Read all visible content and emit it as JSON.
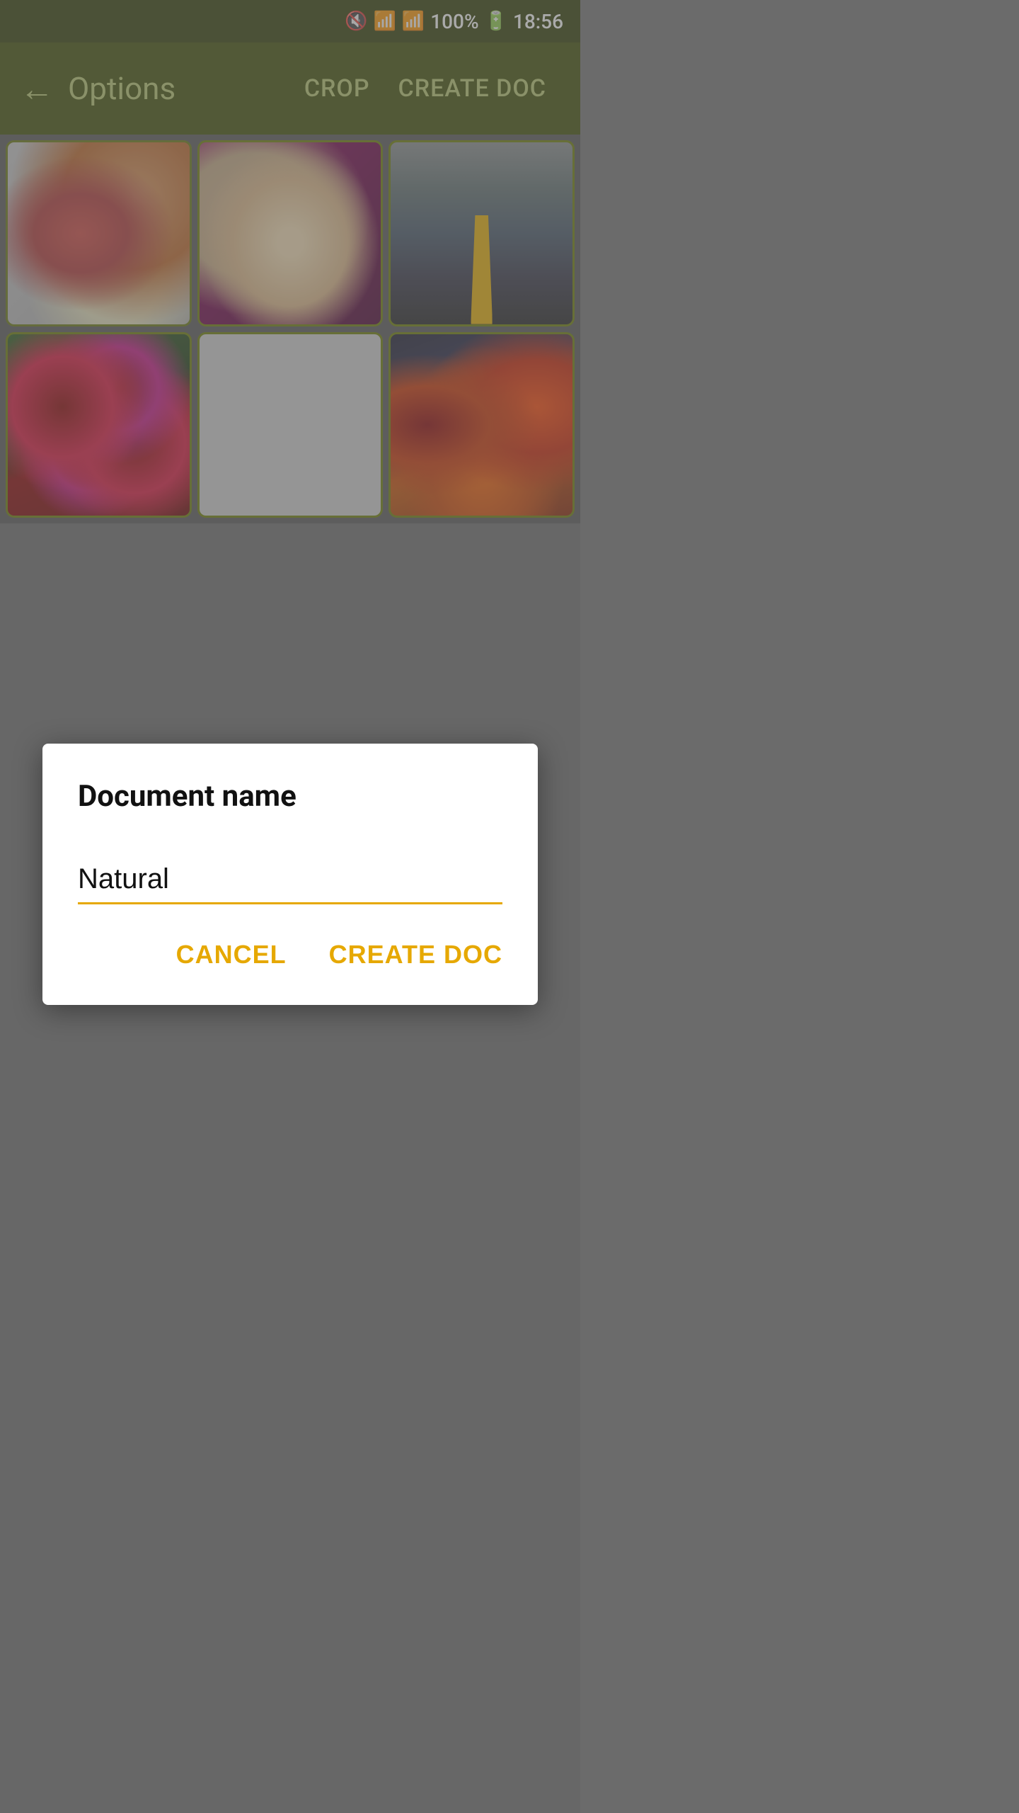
{
  "statusBar": {
    "time": "18:56",
    "battery": "100%",
    "icons": [
      "mute-icon",
      "wifi-icon",
      "signal-icon",
      "battery-icon"
    ]
  },
  "appBar": {
    "backLabel": "←",
    "title": "Options",
    "cropLabel": "CROP",
    "createDocLabel": "CREATE DOC"
  },
  "imageGrid": {
    "cells": [
      {
        "id": "flowers",
        "alt": "Floral fabric"
      },
      {
        "id": "dolphin",
        "alt": "Dolphin sculpture"
      },
      {
        "id": "road",
        "alt": "Autumn road"
      },
      {
        "id": "cherries",
        "alt": "Cherries"
      },
      {
        "id": "empty",
        "alt": "Empty"
      },
      {
        "id": "autumn",
        "alt": "Autumn forest"
      }
    ]
  },
  "dialog": {
    "title": "Document name",
    "inputValue": "Natural",
    "inputPlaceholder": "Natural",
    "cancelLabel": "CANCEL",
    "createDocLabel": "CREATE DOC"
  }
}
